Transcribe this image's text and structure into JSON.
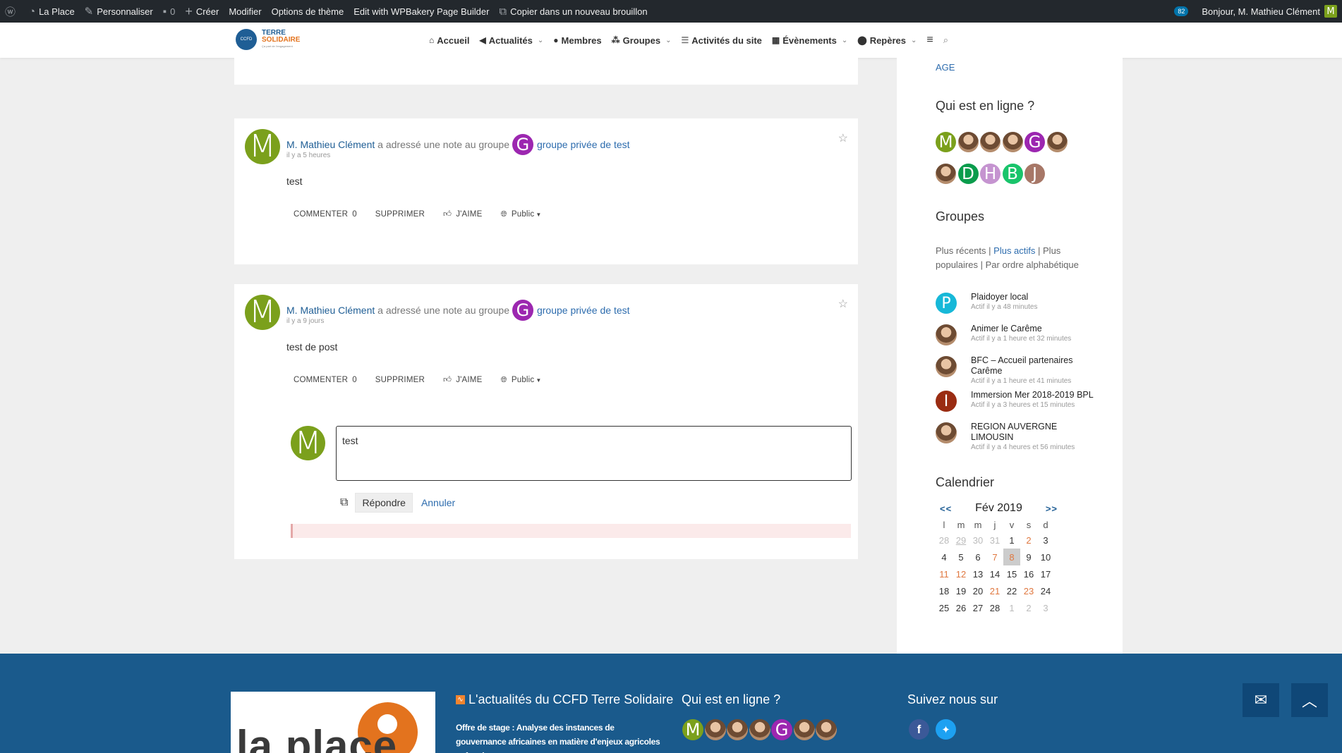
{
  "adminbar": {
    "site": "La Place",
    "customize": "Personnaliser",
    "comments": "0",
    "create": "Créer",
    "edit": "Modifier",
    "theme_options": "Options de thème",
    "wpbakery": "Edit with WPBakery Page Builder",
    "copy_draft": "Copier dans un nouveau brouillon",
    "notif_count": "82",
    "greeting": "Bonjour, M. Mathieu Clément",
    "avatar_letter": "M"
  },
  "logo": {
    "line1": "TERRE",
    "line2": "SOLIDAIRE",
    "badge": "CCFD",
    "tagline": "Ça part de l'engagement"
  },
  "nav": {
    "items": [
      {
        "label": "Accueil",
        "icon": "home-icon"
      },
      {
        "label": "Actualités",
        "icon": "bullhorn-icon"
      },
      {
        "label": "Membres",
        "icon": "users-icon"
      },
      {
        "label": "Groupes",
        "icon": "sitemap-icon"
      },
      {
        "label": "Activités du site",
        "icon": "list-icon"
      },
      {
        "label": "Évènements",
        "icon": "calendar-icon"
      },
      {
        "label": "Repères",
        "icon": "map-marker-icon"
      }
    ]
  },
  "activities": [
    {
      "user": "M. Mathieu Clément",
      "action": "a adressé une note au groupe",
      "group_letter": "G",
      "group": "groupe privée de test",
      "time": "il y a 5 heures",
      "content": "test",
      "comment": "COMMENTER",
      "comment_count": "0",
      "delete": "SUPPRIMER",
      "like": "J'AIME",
      "visibility": "Public",
      "avatar_letter": "M"
    },
    {
      "user": "M. Mathieu Clément",
      "action": "a adressé une note au groupe",
      "group_letter": "G",
      "group": "groupe privée de test",
      "time": "il y a 9 jours",
      "content": "test de post",
      "comment": "COMMENTER",
      "comment_count": "0",
      "delete": "SUPPRIMER",
      "like": "J'AIME",
      "visibility": "Public",
      "avatar_letter": "M"
    }
  ],
  "reply": {
    "avatar_letter": "M",
    "text": "test",
    "submit": "Répondre",
    "cancel": "Annuler"
  },
  "sidebar": {
    "top_link": "AGE",
    "online_title": "Qui est en ligne ?",
    "online_avatars": [
      {
        "letter": "M",
        "color": "#7ba01c"
      },
      {
        "letter": "",
        "color": "photo"
      },
      {
        "letter": "",
        "color": "photo"
      },
      {
        "letter": "",
        "color": "photo"
      },
      {
        "letter": "G",
        "color": "#9c27b0"
      },
      {
        "letter": "",
        "color": "photo"
      },
      {
        "letter": "",
        "color": "photo"
      },
      {
        "letter": "D",
        "color": "#0a9c4c"
      },
      {
        "letter": "H",
        "color": "#c594d0"
      },
      {
        "letter": "B",
        "color": "#19c46b"
      },
      {
        "letter": "J",
        "color": "#a77767"
      }
    ],
    "groups_title": "Groupes",
    "groups_filters": {
      "recent": "Plus récents",
      "active": "Plus actifs",
      "popular": "Plus populaires",
      "alpha": "Par ordre alphabétique"
    },
    "groups": [
      {
        "name": "Plaidoyer local",
        "activity": "Actif il y a 48 minutes",
        "color": "#17b8d8",
        "letter": "P"
      },
      {
        "name": "Animer le Carême",
        "activity": "Actif il y a 1 heure et 32 minutes",
        "color": "photo",
        "letter": ""
      },
      {
        "name": "BFC – Accueil partenaires Carême",
        "activity": "Actif il y a 1 heure et 41 minutes",
        "color": "photo",
        "letter": ""
      },
      {
        "name": "Immersion Mer 2018-2019 BPL",
        "activity": "Actif il y a 3 heures et 15 minutes",
        "color": "#9a2c12",
        "letter": "I"
      },
      {
        "name": "REGION AUVERGNE LIMOUSIN",
        "activity": "Actif il y a 4 heures et 56 minutes",
        "color": "photo",
        "letter": ""
      }
    ],
    "calendar_title": "Calendrier",
    "calendar": {
      "prev": "<<",
      "next": ">>",
      "month": "Fév 2019",
      "weekdays": [
        "l",
        "m",
        "m",
        "j",
        "v",
        "s",
        "d"
      ],
      "weeks": [
        [
          "28",
          "29",
          "30",
          "31",
          "1",
          "2",
          "3"
        ],
        [
          "4",
          "5",
          "6",
          "7",
          "8",
          "9",
          "10"
        ],
        [
          "11",
          "12",
          "13",
          "14",
          "15",
          "16",
          "17"
        ],
        [
          "18",
          "19",
          "20",
          "21",
          "22",
          "23",
          "24"
        ],
        [
          "25",
          "26",
          "27",
          "28",
          "1",
          "2",
          "3"
        ]
      ]
    }
  },
  "footer": {
    "logo_text": "la place",
    "news_title": "L'actualités du CCFD Terre Solidaire",
    "news_item": "Offre de stage : Analyse des instances de gouvernance africaines en matière d'enjeux agricoles et fonciers",
    "online_title": "Qui est en ligne ?",
    "follow_title": "Suivez nous sur",
    "online_avatars": [
      {
        "letter": "M",
        "color": "#7ba01c"
      },
      {
        "letter": "",
        "color": "photo"
      },
      {
        "letter": "",
        "color": "photo"
      },
      {
        "letter": "",
        "color": "photo"
      },
      {
        "letter": "G",
        "color": "#9c27b0"
      },
      {
        "letter": "",
        "color": "photo"
      },
      {
        "letter": "",
        "color": "photo"
      }
    ]
  }
}
